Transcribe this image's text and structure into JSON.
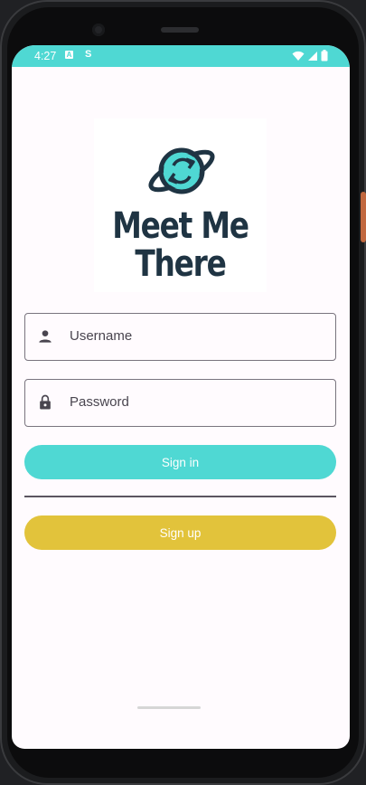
{
  "status_bar": {
    "time": "4:27",
    "notification_a": "A",
    "notification_s": "S",
    "color": "#4fd8d3"
  },
  "logo": {
    "line1": "Meet Me",
    "line2": "There",
    "text_color": "#1f3443",
    "icon": "planet-arrows-icon"
  },
  "login_form": {
    "username_label": "Username",
    "password_label": "Password",
    "username_icon": "person-icon",
    "password_icon": "lock-icon"
  },
  "buttons": {
    "sign_in_label": "Sign in",
    "sign_up_label": "Sign up",
    "sign_in_color": "#4fd8d3",
    "sign_up_color": "#e2c33b"
  }
}
